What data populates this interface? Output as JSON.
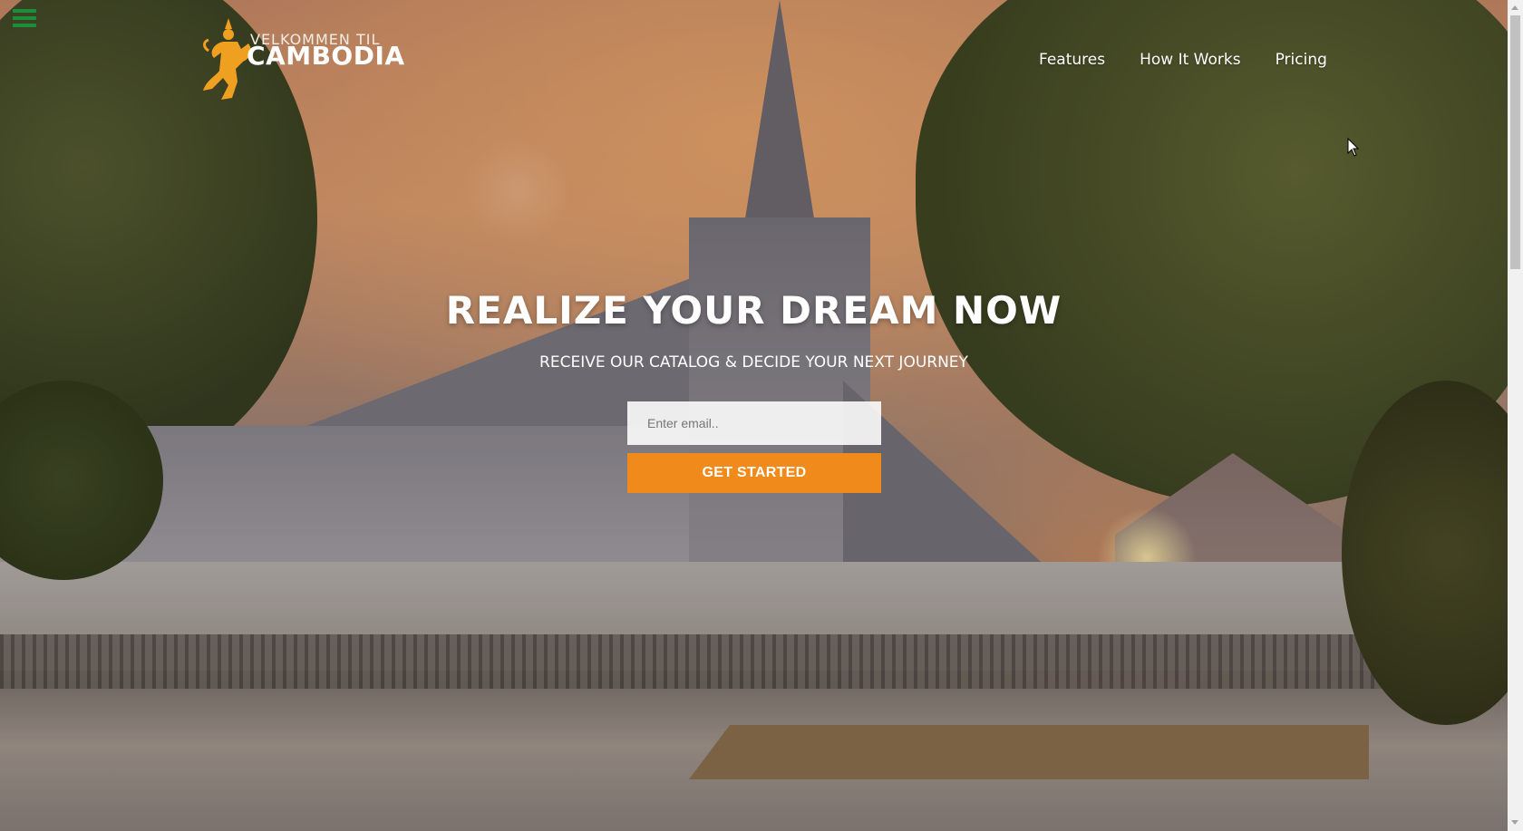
{
  "brand": {
    "tagline": "VELKOMMEN TIL",
    "name": "CAMBODIA"
  },
  "nav": {
    "items": [
      "Features",
      "How It Works",
      "Pricing"
    ]
  },
  "hero": {
    "headline": "REALIZE YOUR DREAM NOW",
    "subheadline": "RECEIVE OUR CATALOG & DECIDE YOUR NEXT JOURNEY",
    "email_placeholder": "Enter email..",
    "cta_label": "GET STARTED"
  },
  "colors": {
    "accent": "#f08a1a",
    "menu_icon": "#1b8f3a",
    "logo_figure": "#f0a020"
  },
  "icons": {
    "menu": "hamburger-icon",
    "logo": "apsara-dancer-icon",
    "cursor": "mouse-pointer-icon"
  }
}
